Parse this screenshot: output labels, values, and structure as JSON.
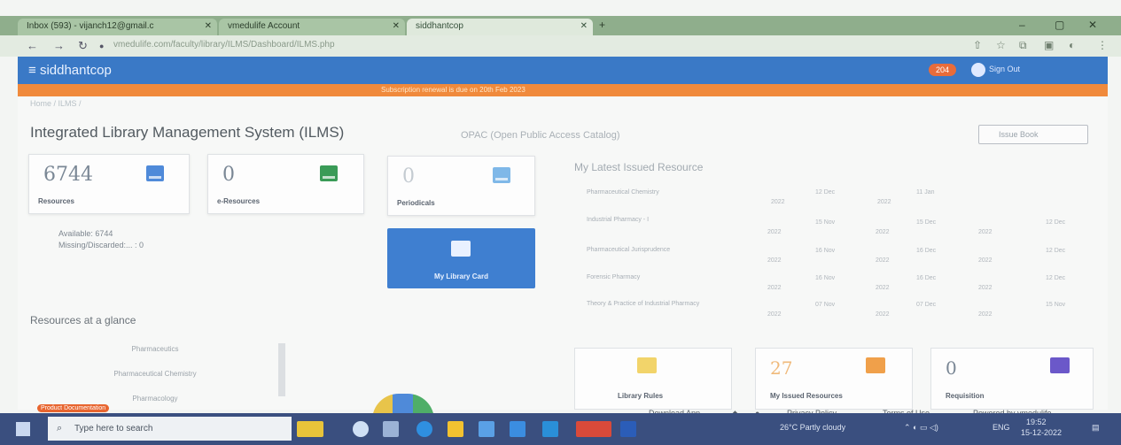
{
  "browser": {
    "tabs": [
      {
        "label": "Inbox (593) - vijanch12@gmail.c",
        "active": false
      },
      {
        "label": "vmedulife Account",
        "active": false
      },
      {
        "label": "siddhantcop",
        "active": true
      }
    ],
    "url": "vmedulife.com/faculty/library/ILMS/Dashboard/ILMS.php"
  },
  "app": {
    "brand": "siddhantcop",
    "notif_badge": "204",
    "user": "Sign Out",
    "marquee": "Subscription renewal is due on 20th Feb 2023",
    "breadcrumb": "Home / ILMS /",
    "title": "Integrated Library Management System (ILMS)",
    "opac": "OPAC (Open Public Access Catalog)",
    "top_button": "Issue Book"
  },
  "stats": [
    {
      "value": "6744",
      "label": "Resources",
      "color": "#4f8ad9"
    },
    {
      "value": "0",
      "label": "e-Resources",
      "color": "#3a9b57"
    },
    {
      "value": "0",
      "label": "Periodicals",
      "color": "#7fb8e8"
    }
  ],
  "availability": {
    "available": "Available: 6744",
    "missing": "Missing/Discarded:... : 0"
  },
  "library_card": {
    "label": "My Library Card"
  },
  "latest": {
    "title": "My Latest Issued Resource",
    "rows": [
      {
        "name": "Pharmaceutical Chemistry",
        "y1": "2022",
        "d1": "12 Dec",
        "y2": "2022",
        "d2": "11 Jan",
        "y3": "",
        "d3": ""
      },
      {
        "name": "Industrial Pharmacy - I",
        "y1": "2022",
        "d1": "15 Nov",
        "y2": "2022",
        "d2": "15 Dec",
        "y3": "2022",
        "d3": "12 Dec"
      },
      {
        "name": "Pharmaceutical Jurisprudence",
        "y1": "2022",
        "d1": "16 Nov",
        "y2": "2022",
        "d2": "16 Dec",
        "y3": "2022",
        "d3": "12 Dec"
      },
      {
        "name": "Forensic Pharmacy",
        "y1": "2022",
        "d1": "16 Nov",
        "y2": "2022",
        "d2": "16 Dec",
        "y3": "2022",
        "d3": "12 Dec"
      },
      {
        "name": "Theory & Practice of Industrial Pharmacy",
        "y1": "2022",
        "d1": "07 Nov",
        "y2": "2022",
        "d2": "07 Dec",
        "y3": "2022",
        "d3": "15 Nov"
      }
    ]
  },
  "glance": {
    "title": "Resources at a glance",
    "items": [
      "Pharmaceutics",
      "Pharmaceutical Chemistry",
      "Pharmacology"
    ]
  },
  "bottom_cards": [
    {
      "value": "",
      "label": "Library Rules",
      "color": "#f2d46a"
    },
    {
      "value": "27",
      "label": "My Issued Resources",
      "color": "#f0a04a"
    },
    {
      "value": "0",
      "label": "Requisition",
      "color": "#6b58c9"
    }
  ],
  "product_tag": "Product Documentation",
  "footer": {
    "download": "Download App",
    "privacy": "Privacy Policy",
    "terms": "Terms of Use",
    "powered": "Powered by vmedulife"
  },
  "taskbar": {
    "search_placeholder": "Type here to search",
    "weather": "26°C Partly cloudy",
    "lang": "ENG",
    "time": "19:52",
    "date": "15-12-2022"
  }
}
